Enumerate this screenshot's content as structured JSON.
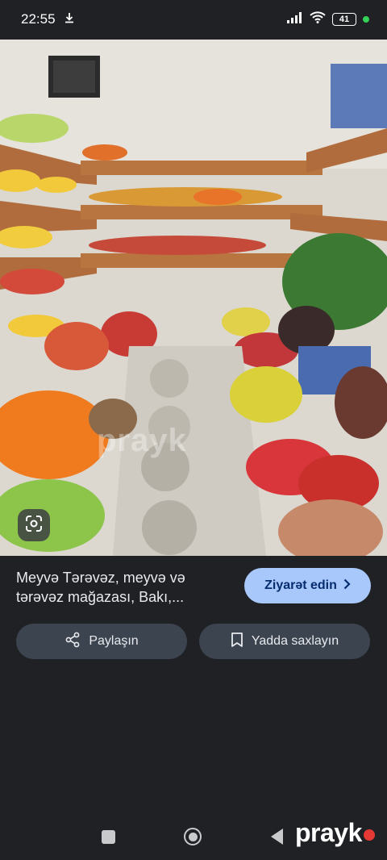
{
  "status": {
    "time": "22:55",
    "battery": "41",
    "accent": "#34d058"
  },
  "image": {
    "watermark": "prayk",
    "lens_icon": "lens-icon"
  },
  "result": {
    "title": "Meyvə Tərəvəz, meyvə və tərəvəz mağazası, Bakı,...",
    "visit_label": "Ziyarət edin",
    "share_label": "Paylaşın",
    "save_label": "Yadda saxlayın"
  },
  "nav": {
    "brand": "prayk"
  },
  "colors": {
    "background": "#1f2125",
    "visit_button": "#a8c7fa",
    "pill_button": "#3c4450"
  }
}
